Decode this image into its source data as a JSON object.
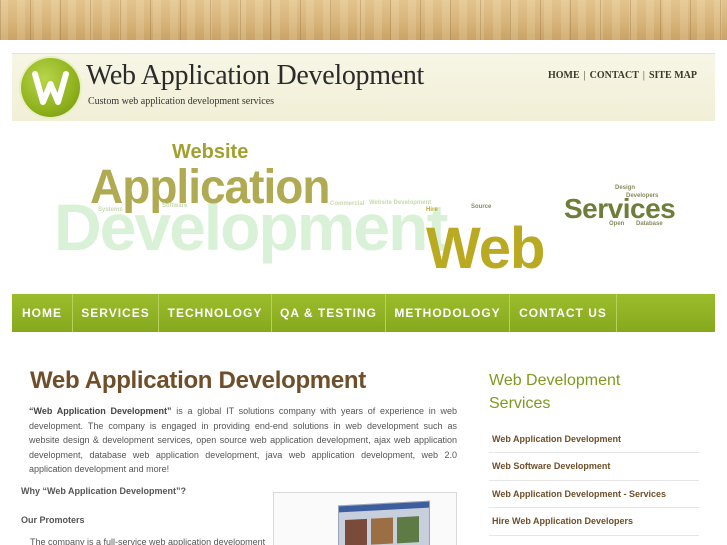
{
  "header": {
    "title": "Web Application Development",
    "tagline": "Custom web application development services",
    "top_links": [
      "HOME",
      "CONTACT",
      "SITE MAP"
    ]
  },
  "banner": {
    "words": {
      "website": "Website",
      "application": "Application",
      "development": "Development",
      "web": "Web",
      "services": "Services",
      "small": [
        "Source",
        "Design",
        "Developers",
        "Open",
        "Database",
        "Commercial",
        "Website Development",
        "Hire",
        "Software",
        "Systems"
      ]
    }
  },
  "nav": [
    "HOME",
    "SERVICES",
    "TECHNOLOGY",
    "QA & TESTING",
    "METHODOLOGY",
    "CONTACT US"
  ],
  "main": {
    "title": "Web Application Development",
    "intro_bold": "“Web Application Development”",
    "intro_rest": " is a global IT solutions company with years of experience in web development. The company is engaged in providing end-end solutions in web development such as website design & development services, open source web application development, ajax web application development, database web application development, java web application development, web 2.0 application development and more!",
    "why_heading": "Why “Web Application Development”?",
    "promoters_heading": "Our Promoters",
    "promoters_text": "The company is a full-service web application development"
  },
  "sidebar": {
    "title": "Web Development Services",
    "items": [
      "Web Application Development",
      "Web Software Development",
      "Web Application Development - Services",
      "Hire Web Application Developers"
    ]
  },
  "colors": {
    "nav_green": "#8fb022",
    "title_brown": "#6f4f2a",
    "sidebar_green": "#7e9a1e",
    "wood": "#d7b47a"
  }
}
